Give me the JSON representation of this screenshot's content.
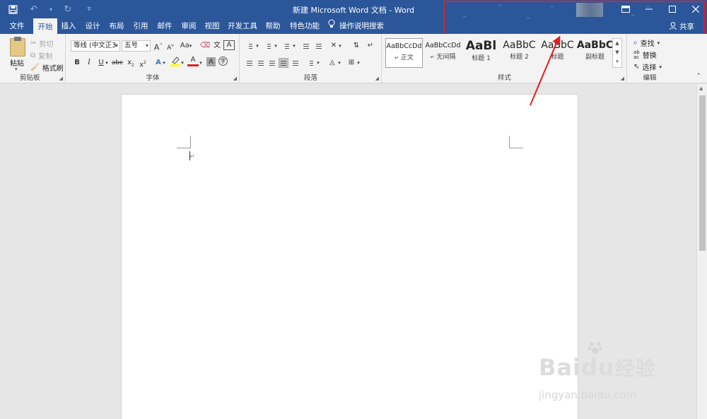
{
  "window": {
    "title": "新建 Microsoft Word 文档 - Word",
    "controls": [
      "ribbon-display-options",
      "minimize",
      "maximize",
      "close"
    ],
    "share_label": "共享"
  },
  "quick_access": {
    "save_icon": "save-icon",
    "undo_icon": "undo-icon",
    "redo_icon": "redo-icon",
    "customize_icon": "customize-qat-icon"
  },
  "tabs": [
    {
      "label": "文件",
      "active": false
    },
    {
      "label": "开始",
      "active": true
    },
    {
      "label": "插入",
      "active": false
    },
    {
      "label": "设计",
      "active": false
    },
    {
      "label": "布局",
      "active": false
    },
    {
      "label": "引用",
      "active": false
    },
    {
      "label": "邮件",
      "active": false
    },
    {
      "label": "审阅",
      "active": false
    },
    {
      "label": "视图",
      "active": false
    },
    {
      "label": "开发工具",
      "active": false
    },
    {
      "label": "帮助",
      "active": false
    },
    {
      "label": "特色功能",
      "active": false
    }
  ],
  "tell_me": {
    "label": "操作说明搜索",
    "icon": "lightbulb-icon"
  },
  "ribbon": {
    "clipboard": {
      "label": "剪贴板",
      "paste": "粘贴",
      "cut": "剪切",
      "copy": "复制",
      "format_painter": "格式刷"
    },
    "font": {
      "label": "字体",
      "font_name": "等线 (中文正3",
      "font_size": "五号",
      "grow": "A",
      "shrink": "A",
      "change_case": "Aa",
      "bold": "B",
      "italic": "I",
      "underline": "U",
      "strikethrough": "abc",
      "subscript": "x",
      "superscript": "x",
      "font_color_letter": "A",
      "highlight_color": "#ffff00",
      "font_color": "#e02020",
      "char_shading": "A",
      "enclose": "字"
    },
    "paragraph": {
      "label": "段落"
    },
    "styles": {
      "label": "样式",
      "items": [
        {
          "sample": "AaBbCcDd",
          "name": "正文",
          "marker": "↵"
        },
        {
          "sample": "AaBbCcDd",
          "name": "无间隔",
          "marker": "↵"
        },
        {
          "sample": "AaBl",
          "name": "标题 1",
          "marker": ""
        },
        {
          "sample": "AaBbC",
          "name": "标题 2",
          "marker": ""
        },
        {
          "sample": "AaBbC",
          "name": "标题",
          "marker": ""
        },
        {
          "sample": "AaBbC",
          "name": "副标题",
          "marker": ""
        }
      ]
    },
    "editing": {
      "label": "编辑",
      "find": "查找",
      "replace": "替换",
      "select": "选择"
    }
  },
  "watermark": {
    "brand_text": "Bai",
    "brand_text2": "du",
    "brand_cn": "经验",
    "url": "jingyan.baidu.com"
  },
  "colors": {
    "title_bar": "#2b579a",
    "ribbon_bg": "#f3f3f3",
    "annotation": "#e02020"
  }
}
